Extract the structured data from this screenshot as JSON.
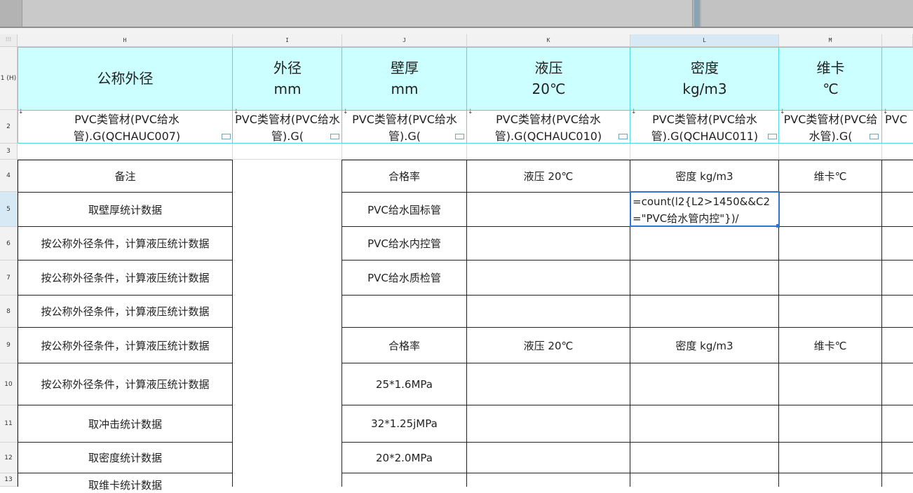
{
  "columns": [
    "H",
    "I",
    "J",
    "K",
    "L",
    "M"
  ],
  "rows": [
    "1 (H)",
    "2",
    "3",
    "4",
    "5",
    "6",
    "7",
    "8",
    "9",
    "10",
    "11",
    "12",
    "13"
  ],
  "header_row1": {
    "H": [
      "公称外径"
    ],
    "I": [
      "外径",
      "mm"
    ],
    "J": [
      "壁厚",
      "mm"
    ],
    "K": [
      "液压",
      "20℃"
    ],
    "L": [
      "密度",
      "kg/m3"
    ],
    "M": [
      "维卡",
      "℃"
    ]
  },
  "row2": {
    "H": "PVC类管材(PVC给水管).G(QCHAUC007)",
    "I": "PVC类管材(PVC给水管).G(",
    "J": "PVC类管材(PVC给水管).G(",
    "K": "PVC类管材(PVC给水管).G(QCHAUC010)",
    "L": "PVC类管材(PVC给水管).G(QCHAUC011)",
    "M": "PVC类管材(PVC给水管).G(",
    "N": "PVC"
  },
  "col_H": {
    "r4": "备注",
    "r5": "取壁厚统计数据",
    "r6": "按公称外径条件，计算液压统计数据",
    "r7": "按公称外径条件，计算液压统计数据",
    "r8": "按公称外径条件，计算液压统计数据",
    "r9": "按公称外径条件，计算液压统计数据",
    "r10": "按公称外径条件，计算液压统计数据",
    "r11": "取冲击统计数据",
    "r12": "取密度统计数据",
    "r13": "取维卡统计数据"
  },
  "col_J": {
    "r4": "合格率",
    "r5": "PVC给水国标管",
    "r6": "PVC给水内控管",
    "r7": "PVC给水质检管",
    "r9": "合格率",
    "r10": "25*1.6MPa",
    "r11": "32*1.25jMPa",
    "r12": "20*2.0MPa"
  },
  "col_K": {
    "r4": "液压 20℃",
    "r9": "液压 20℃"
  },
  "col_L": {
    "r4": "密度 kg/m3",
    "r9": "密度 kg/m3"
  },
  "col_M": {
    "r4": "维卡℃",
    "r9": "维卡℃"
  },
  "edit_formula": "=count(l2{L2>1450&&C2=\"PVC给水管内控\"})/",
  "colors": {
    "header_fill": "#ccffff",
    "selection": "#2f74d0",
    "header_selected": "#d7e9f5"
  }
}
